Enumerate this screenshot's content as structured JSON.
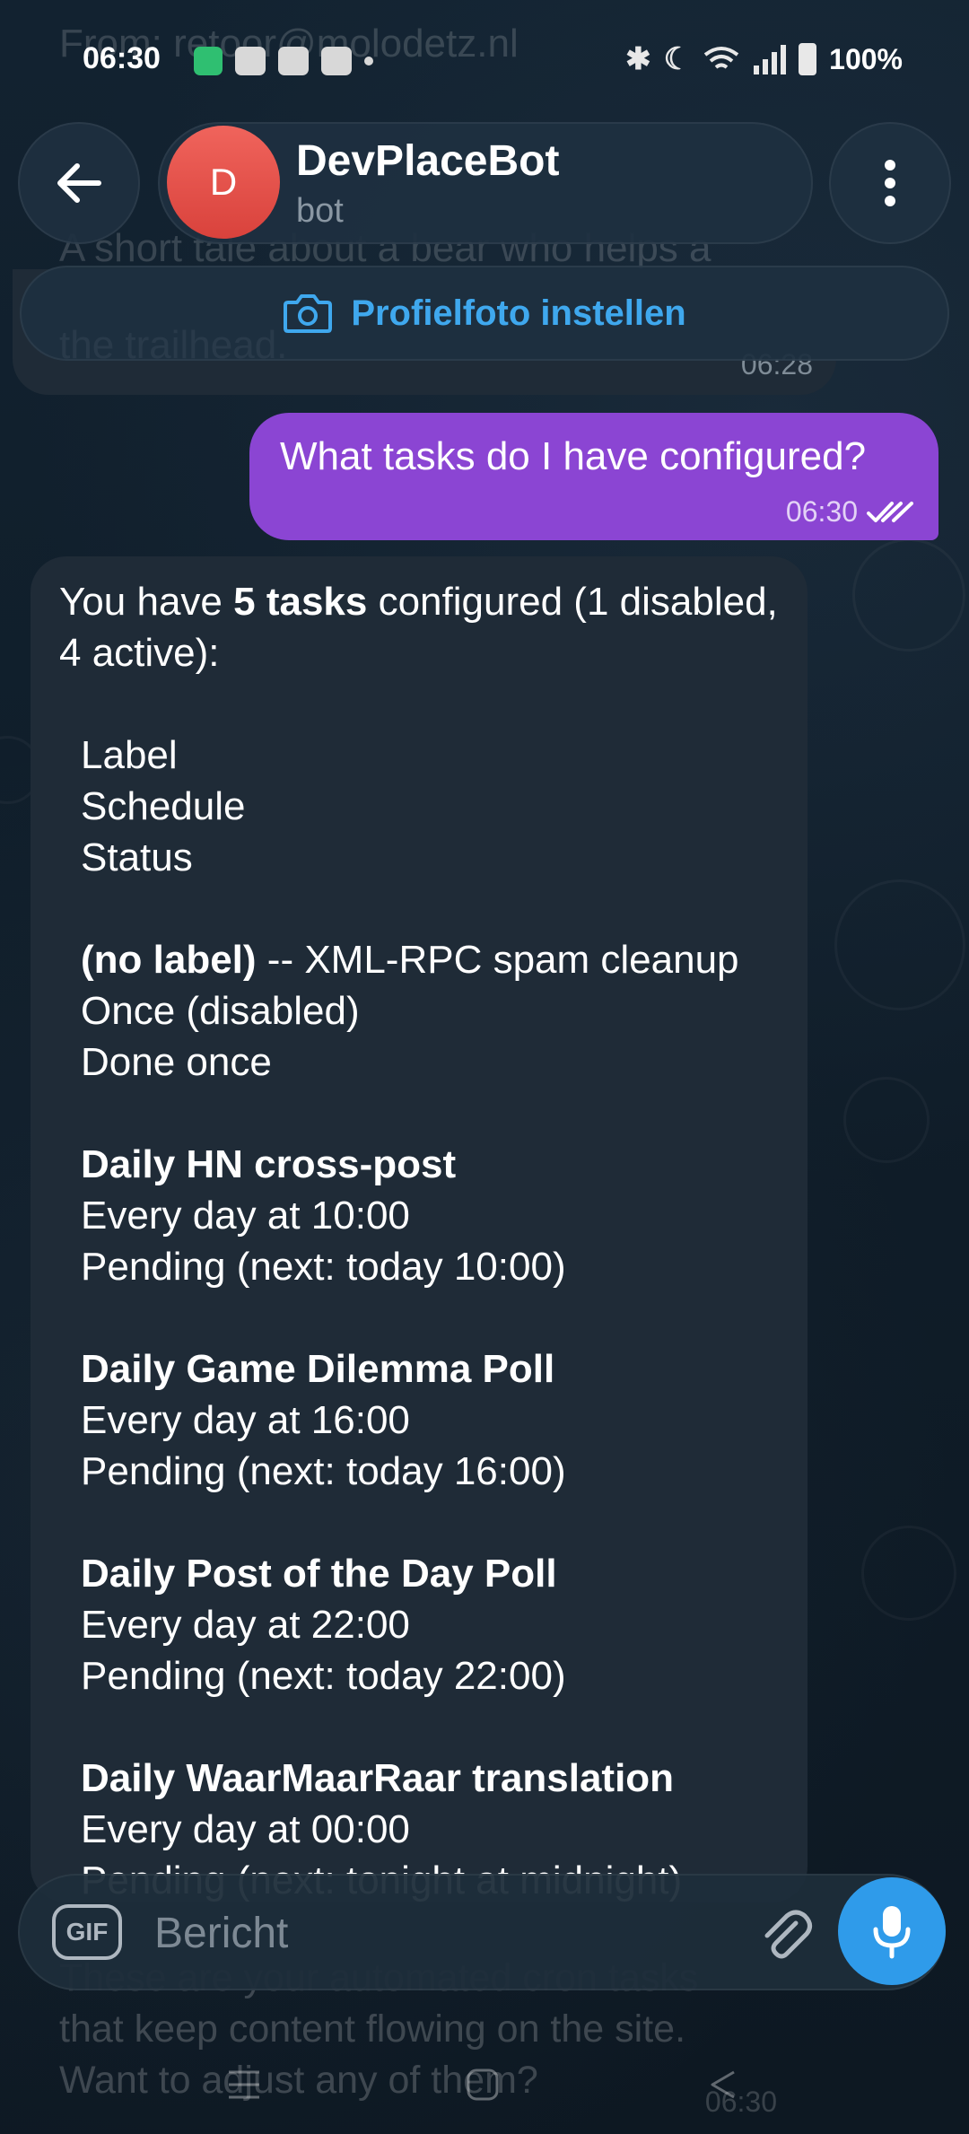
{
  "status_bar": {
    "time": "06:30",
    "battery": "100%"
  },
  "background": {
    "ghost_line_1": "From: retoor@molodetz.nl",
    "ghost_line_2": "A short tale about a bear who helps a",
    "tail_lines": [
      "These are your automated cron tasks",
      "that keep content flowing on the site.",
      "Want to adjust any of them?"
    ],
    "tail_time": "06:30"
  },
  "header": {
    "avatar_letter": "D",
    "chat_name": "DevPlaceBot",
    "chat_subtitle": "bot"
  },
  "banner": {
    "label": "Profielfoto instellen"
  },
  "previous_message": {
    "text": "the trailhead.",
    "time": "06:28"
  },
  "outgoing_message": {
    "text": "What tasks do I have configured?",
    "time": "06:30"
  },
  "incoming_message": {
    "intro_prefix": "You have ",
    "intro_bold": "5 tasks",
    "intro_suffix": " configured (1 disabled, 4 active):",
    "columns": [
      "Label",
      "Schedule",
      "Status"
    ],
    "tasks": [
      {
        "label": "(no label)",
        "label_suffix": " -- XML-RPC spam cleanup",
        "schedule": "Once (disabled)",
        "status": "Done once"
      },
      {
        "label": "Daily HN cross-post",
        "label_suffix": "",
        "schedule": "Every day at 10:00",
        "status": "Pending (next: today 10:00)"
      },
      {
        "label": "Daily Game Dilemma Poll",
        "label_suffix": "",
        "schedule": "Every day at 16:00",
        "status": "Pending (next: today 16:00)"
      },
      {
        "label": "Daily Post of the Day Poll",
        "label_suffix": "",
        "schedule": "Every day at 22:00",
        "status": "Pending (next: today 22:00)"
      },
      {
        "label": "Daily WaarMaarRaar translation",
        "label_suffix": "",
        "schedule": "Every day at 00:00",
        "status": "Pending (next: tonight at midnight)"
      }
    ]
  },
  "composer": {
    "gif_label": "GIF",
    "placeholder": "Bericht"
  },
  "colors": {
    "accent": "#2f9bea",
    "outgoing_bubble": "#8b45d3",
    "incoming_bubble": "#1f2b37",
    "avatar": "#e4544d"
  },
  "icons": [
    "back-arrow-icon",
    "more-vert-icon",
    "camera-icon",
    "paperclip-icon",
    "microphone-icon",
    "double-check-icon"
  ]
}
